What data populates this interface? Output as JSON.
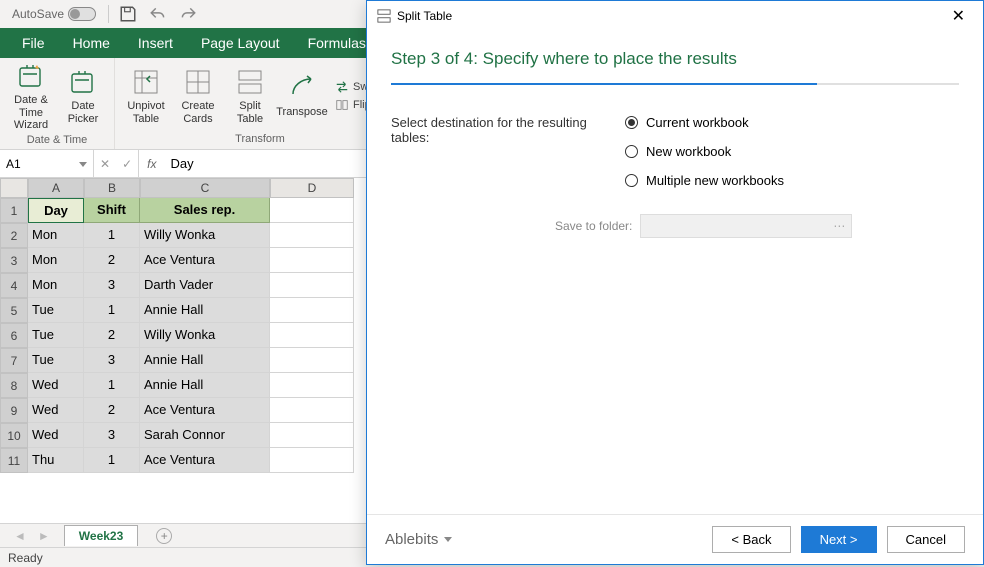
{
  "titlebar": {
    "autosave": "AutoSave"
  },
  "tabs": {
    "file": "File",
    "home": "Home",
    "insert": "Insert",
    "page_layout": "Page Layout",
    "formulas": "Formulas"
  },
  "ribbon": {
    "datetime": {
      "btn1": "Date & Time Wizard",
      "btn2": "Date Picker",
      "group": "Date & Time"
    },
    "transform": {
      "btn1": "Unpivot Table",
      "btn2": "Create Cards",
      "btn3": "Split Table",
      "btn4": "Transpose",
      "swap": "Swap",
      "flip": "Flip",
      "group": "Transform"
    }
  },
  "formula_bar": {
    "cell_ref": "A1",
    "fx": "fx",
    "value": "Day"
  },
  "grid": {
    "cols": [
      "A",
      "B",
      "C",
      "D"
    ],
    "headers": {
      "c1": "Day",
      "c2": "Shift",
      "c3": "Sales rep."
    },
    "rows": [
      {
        "n": "1"
      },
      {
        "n": "2",
        "day": "Mon",
        "shift": "1",
        "rep": "Willy Wonka"
      },
      {
        "n": "3",
        "day": "Mon",
        "shift": "2",
        "rep": "Ace Ventura"
      },
      {
        "n": "4",
        "day": "Mon",
        "shift": "3",
        "rep": "Darth Vader"
      },
      {
        "n": "5",
        "day": "Tue",
        "shift": "1",
        "rep": "Annie Hall"
      },
      {
        "n": "6",
        "day": "Tue",
        "shift": "2",
        "rep": "Willy Wonka"
      },
      {
        "n": "7",
        "day": "Tue",
        "shift": "3",
        "rep": "Annie Hall"
      },
      {
        "n": "8",
        "day": "Wed",
        "shift": "1",
        "rep": "Annie Hall"
      },
      {
        "n": "9",
        "day": "Wed",
        "shift": "2",
        "rep": "Ace Ventura"
      },
      {
        "n": "10",
        "day": "Wed",
        "shift": "3",
        "rep": "Sarah Connor"
      },
      {
        "n": "11",
        "day": "Thu",
        "shift": "1",
        "rep": "Ace Ventura"
      }
    ]
  },
  "sheet_tab": "Week23",
  "status": "Ready",
  "dialog": {
    "title": "Split Table",
    "step": "Step 3 of 4: Specify where to place the results",
    "label": "Select destination for the resulting tables:",
    "opt1": "Current workbook",
    "opt2": "New workbook",
    "opt3": "Multiple new workbooks",
    "save_label": "Save to folder:",
    "brand": "Ablebits",
    "back": "< Back",
    "next": "Next >",
    "cancel": "Cancel"
  }
}
